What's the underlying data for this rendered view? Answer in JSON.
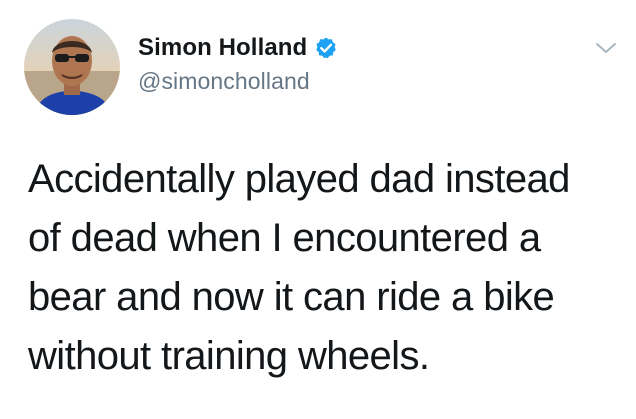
{
  "tweet": {
    "author": {
      "display_name": "Simon Holland",
      "handle": "@simoncholland",
      "verified": true,
      "avatar_icon": "profile-photo"
    },
    "text_lines": [
      "Accidentally played dad instead",
      "of dead when I encountered a",
      "bear and now it can ride a bike",
      "without training wheels."
    ],
    "menu_icon": "chevron-down-icon"
  },
  "colors": {
    "text": "#14171a",
    "secondary_text": "#657786",
    "verified_badge": "#1da1f2",
    "caret": "#aab8c2",
    "background": "#ffffff"
  }
}
